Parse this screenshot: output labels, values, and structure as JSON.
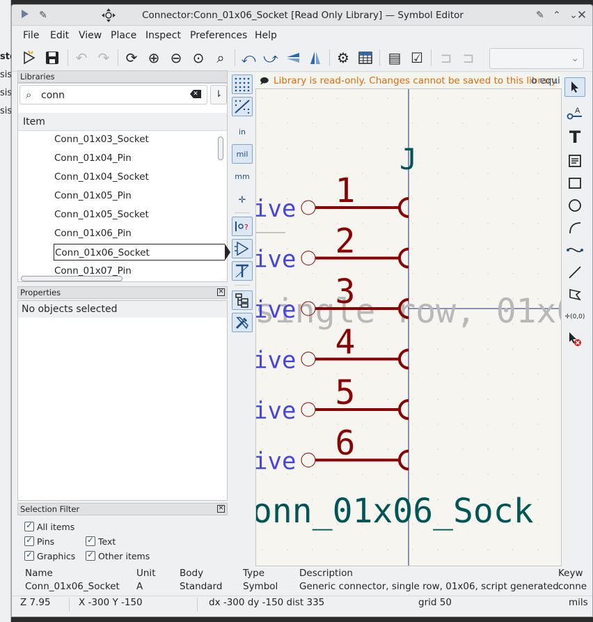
{
  "window": {
    "title": "Connector:Conn_01x06_Socket [Read Only Library] — Symbol Editor"
  },
  "menu": [
    "File",
    "Edit",
    "View",
    "Place",
    "Inspect",
    "Preferences",
    "Help"
  ],
  "libraries": {
    "header": "Libraries",
    "search_value": "conn",
    "column_header": "Item",
    "items": [
      "Conn_01x03_Socket",
      "Conn_01x04_Pin",
      "Conn_01x04_Socket",
      "Conn_01x05_Pin",
      "Conn_01x05_Socket",
      "Conn_01x06_Pin",
      "Conn_01x06_Socket",
      "Conn_01x07_Pin"
    ],
    "selected_index": 6
  },
  "properties": {
    "header": "Properties",
    "message": "No objects selected"
  },
  "selection_filter": {
    "header": "Selection Filter",
    "items": [
      {
        "label": "All items",
        "checked": true
      },
      {
        "label": "Pins",
        "checked": true
      },
      {
        "label": "Text",
        "checked": true
      },
      {
        "label": "Graphics",
        "checked": true
      },
      {
        "label": "Other items",
        "checked": true
      }
    ]
  },
  "vtoolbar_labels": {
    "in": "in",
    "mil": "mil",
    "mm": "mm"
  },
  "infobar": {
    "message": "Library is read-only.  Changes cannot be saved to this library.",
    "truncated_suffix": "o equi"
  },
  "canvas": {
    "reference": "J",
    "pin_type_fragment": "ive",
    "pins": [
      "1",
      "2",
      "3",
      "4",
      "5",
      "6"
    ],
    "description_fragment": "single row, 01x0",
    "value_fragment": "onn_01x06_Sock",
    "colors": {
      "pin": "#8b0000",
      "pin_name": "#4545e5",
      "field": "#005656",
      "background": "#f6f5ef",
      "description": "#b8b8b8"
    }
  },
  "message_panel": [
    {
      "header": "Name",
      "value": "Conn_01x06_Socket"
    },
    {
      "header": "Unit",
      "value": "A"
    },
    {
      "header": "Body",
      "value": "Standard"
    },
    {
      "header": "Type",
      "value": "Symbol"
    },
    {
      "header": "Description",
      "value": "Generic connector, single row, 01x06, script generated"
    },
    {
      "header": "Keyw",
      "value": "conne"
    }
  ],
  "statusbar": {
    "zoom": "Z 7.95",
    "xy": "X -300  Y -150",
    "delta": "dx -300  dy -150  dist 335",
    "grid": "grid 50",
    "units": "mils"
  },
  "background_window_fragments": [
    "sto",
    "sis",
    "sis",
    "sis"
  ]
}
